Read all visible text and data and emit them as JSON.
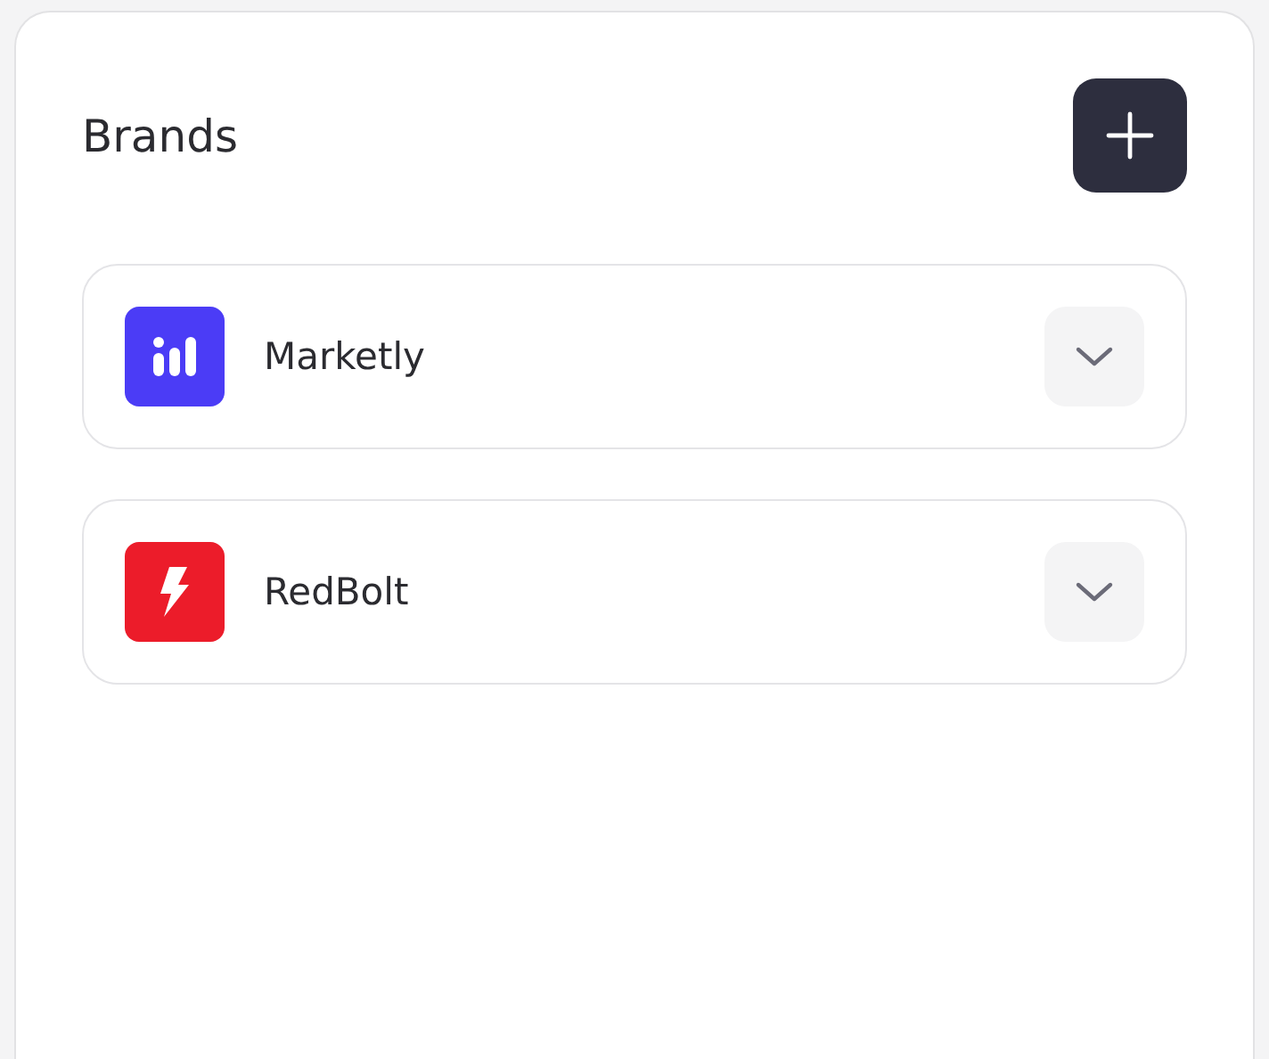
{
  "title": "Brands",
  "brands": [
    {
      "name": "Marketly",
      "kind": "chart",
      "color": "#4b3cf6",
      "expanded": false
    },
    {
      "name": "RedBolt",
      "kind": "bolt",
      "color": "#ec1c2a",
      "expanded": false
    }
  ]
}
